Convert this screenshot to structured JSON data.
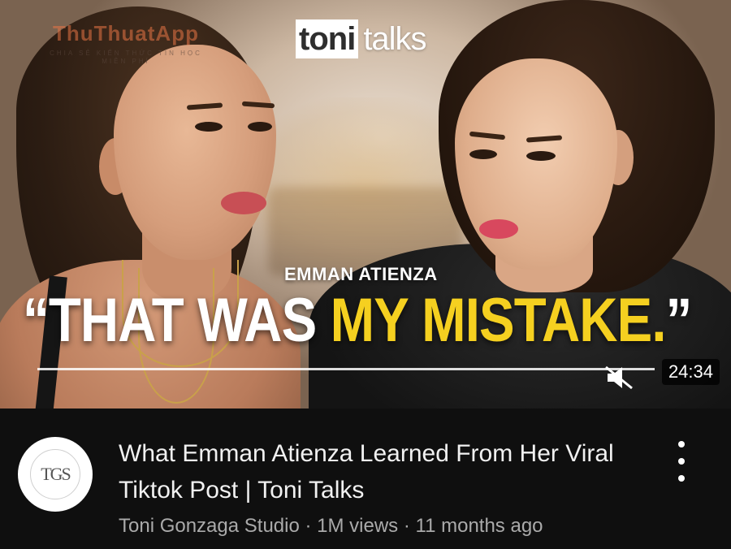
{
  "watermark": {
    "title": "ThuThuatApp",
    "subtitle": "CHIA SẺ KIẾN THỨC TIN HỌC MIỄN PHÍ"
  },
  "thumbnail": {
    "brand_part1": "toni",
    "brand_part2": "talks",
    "kicker": "EMMAN ATIENZA",
    "headline_open_quote": "“",
    "headline_white": "THAT WAS ",
    "headline_yellow": "MY MISTAKE.",
    "headline_close_quote": "”",
    "duration": "24:34",
    "mute_icon": "volume-muted-icon"
  },
  "video": {
    "title": "What Emman Atienza Learned From Her Viral Tiktok Post | Toni Talks",
    "channel": "Toni Gonzaga Studio",
    "separator": " · ",
    "views": "1M views",
    "age": "11 months ago",
    "avatar_text": "TGS",
    "menu_icon": "more-vert-icon"
  },
  "colors": {
    "background": "#0f0f0f",
    "title_text": "#f1f1f1",
    "meta_text": "#aaaaaa",
    "headline_yellow": "#f5d020"
  }
}
